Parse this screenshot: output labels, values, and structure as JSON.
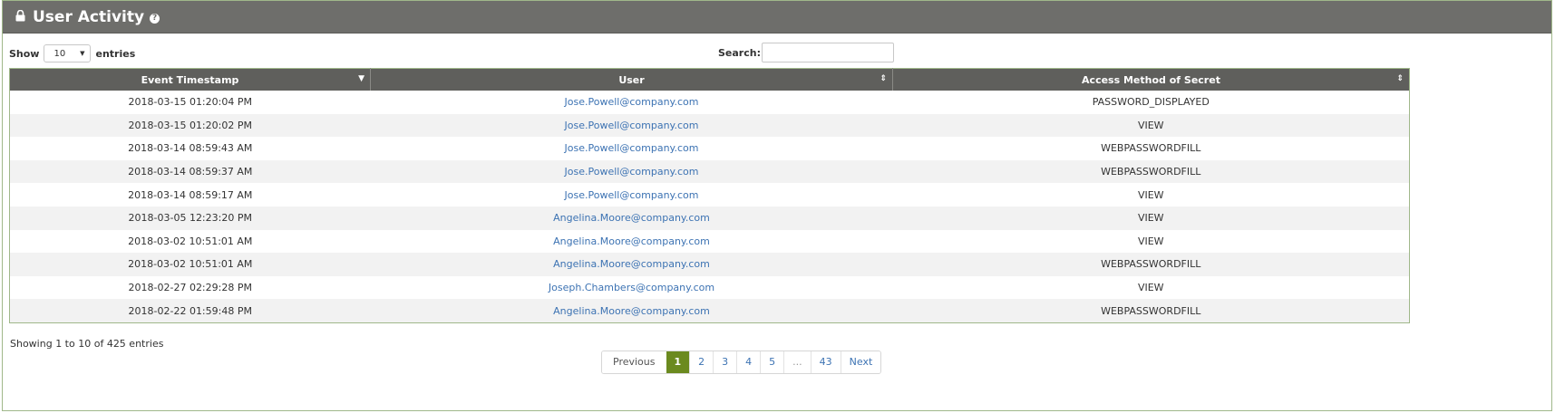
{
  "panel": {
    "title": "User Activity",
    "info_icon": "info-icon"
  },
  "length": {
    "show_label": "Show",
    "selected": "10",
    "entries_label": "entries"
  },
  "search": {
    "label": "Search:",
    "value": ""
  },
  "table": {
    "columns": [
      "Event Timestamp",
      "User",
      "Access Method of Secret"
    ],
    "rows": [
      [
        "2018-03-15 01:20:04 PM",
        "Jose.Powell@company.com",
        "PASSWORD_DISPLAYED"
      ],
      [
        "2018-03-15 01:20:02 PM",
        "Jose.Powell@company.com",
        "VIEW"
      ],
      [
        "2018-03-14 08:59:43 AM",
        "Jose.Powell@company.com",
        "WEBPASSWORDFILL"
      ],
      [
        "2018-03-14 08:59:37 AM",
        "Jose.Powell@company.com",
        "WEBPASSWORDFILL"
      ],
      [
        "2018-03-14 08:59:17 AM",
        "Jose.Powell@company.com",
        "VIEW"
      ],
      [
        "2018-03-05 12:23:20 PM",
        "Angelina.Moore@company.com",
        "VIEW"
      ],
      [
        "2018-03-02 10:51:01 AM",
        "Angelina.Moore@company.com",
        "VIEW"
      ],
      [
        "2018-03-02 10:51:01 AM",
        "Angelina.Moore@company.com",
        "WEBPASSWORDFILL"
      ],
      [
        "2018-02-27 02:29:28 PM",
        "Joseph.Chambers@company.com",
        "VIEW"
      ],
      [
        "2018-02-22 01:59:48 PM",
        "Angelina.Moore@company.com",
        "WEBPASSWORDFILL"
      ]
    ]
  },
  "footer": {
    "info": "Showing 1 to 10 of 425 entries"
  },
  "pagination": {
    "previous": "Previous",
    "pages": [
      "1",
      "2",
      "3",
      "4",
      "5",
      "...",
      "43"
    ],
    "next": "Next",
    "active": "1"
  },
  "colors": {
    "header": "#6e6e6b",
    "active_page": "#6b8a1f",
    "link": "#3d73b3"
  }
}
